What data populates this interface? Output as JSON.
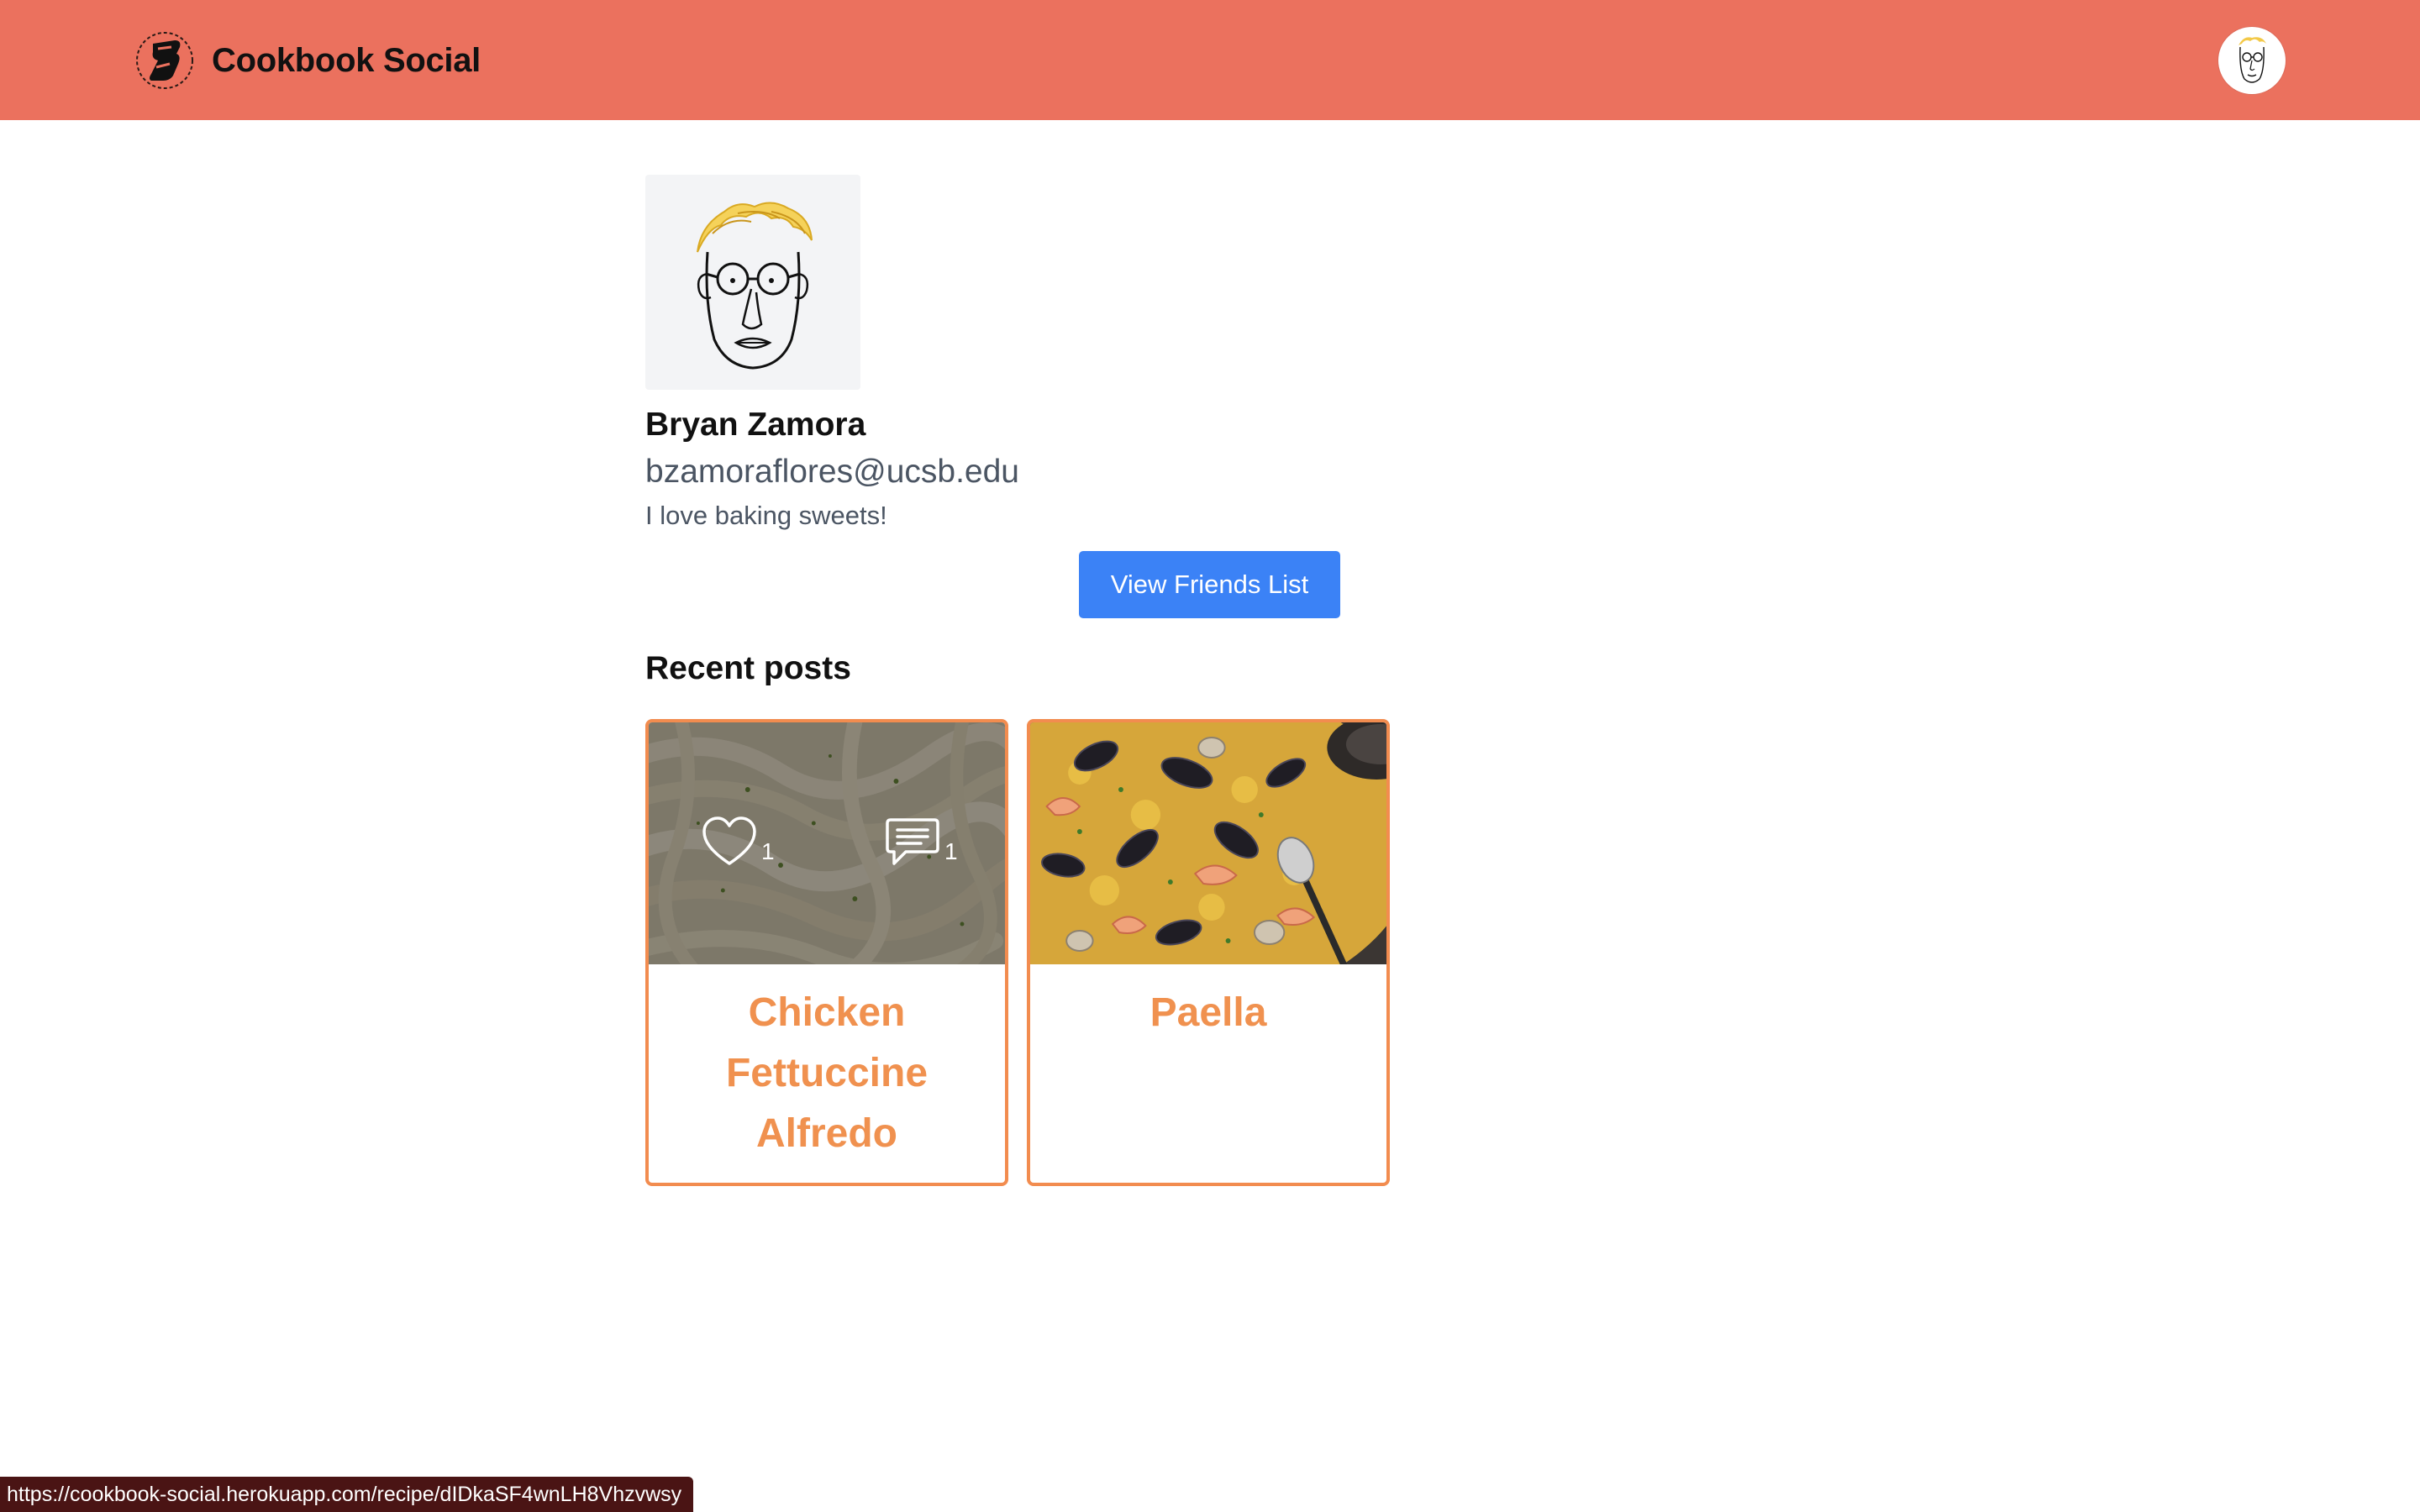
{
  "header": {
    "app_name": "Cookbook Social",
    "brand_color": "#eb715e"
  },
  "profile": {
    "name": "Bryan Zamora",
    "email": "bzamoraflores@ucsb.edu",
    "bio": "I love baking sweets!",
    "friends_button_label": "View Friends List"
  },
  "posts_section": {
    "title": "Recent posts",
    "posts": [
      {
        "title": "Chicken Fettuccine Alfredo",
        "likes": "1",
        "comments": "1",
        "image": "fettuccine-alfredo-photo"
      },
      {
        "title": "Paella",
        "image": "paella-photo"
      }
    ]
  },
  "status_bar": {
    "url": "https://cookbook-social.herokuapp.com/recipe/dIDkaSF4wnLH8Vhzvwsy"
  },
  "colors": {
    "accent": "#f28c4f",
    "button": "#3b82f6"
  }
}
